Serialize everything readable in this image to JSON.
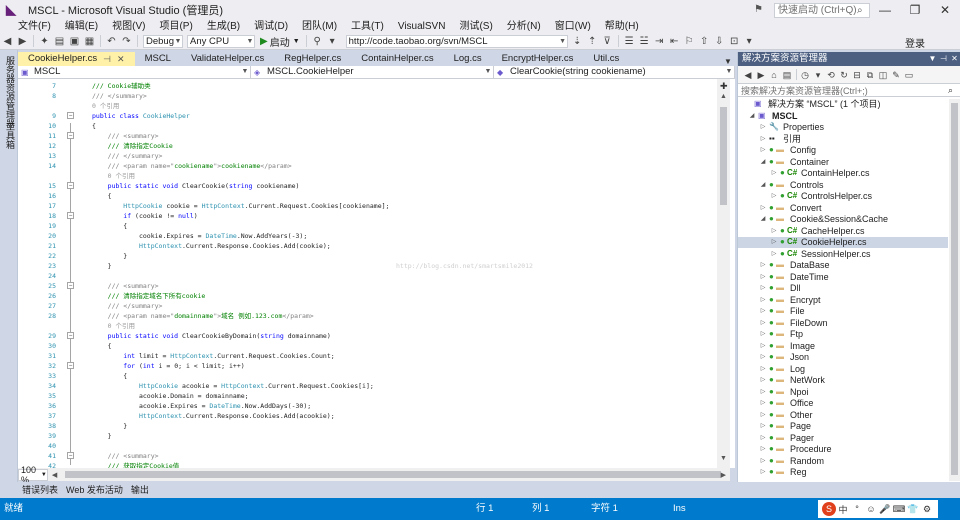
{
  "window": {
    "title": "MSCL - Microsoft Visual Studio (管理员)",
    "quick_launch_placeholder": "快速启动 (Ctrl+Q)",
    "buttons": {
      "minimize": "—",
      "restore": "❐",
      "close": "✕"
    }
  },
  "menu": {
    "items": [
      "文件(F)",
      "编辑(E)",
      "视图(V)",
      "项目(P)",
      "生成(B)",
      "调试(D)",
      "团队(M)",
      "工具(T)",
      "VisualSVN",
      "测试(S)",
      "分析(N)",
      "窗口(W)",
      "帮助(H)"
    ],
    "login": "登录"
  },
  "toolbar": {
    "config": "Debug",
    "platform": "Any CPU",
    "start_label": "启动",
    "url": "http://code.taobao.org/svn/MSCL"
  },
  "left_tabs": [
    "服务器资源管理器",
    "工具箱"
  ],
  "tabs": [
    {
      "label": "CookieHelper.cs",
      "active": true
    },
    {
      "label": "MSCL",
      "active": false
    },
    {
      "label": "ValidateHelper.cs",
      "active": false
    },
    {
      "label": "RegHelper.cs",
      "active": false
    },
    {
      "label": "ContainHelper.cs",
      "active": false
    },
    {
      "label": "Log.cs",
      "active": false
    },
    {
      "label": "EncryptHelper.cs",
      "active": false
    },
    {
      "label": "Util.cs",
      "active": false
    }
  ],
  "navbar": {
    "project": "MSCL",
    "class": "MSCL.CookieHelper",
    "member": "ClearCookie(string cookiename)"
  },
  "editor": {
    "watermark": "http://blog.csdn.net/smartsmile2012",
    "lines": [
      {
        "n": "7",
        "segs": [
          [
            "cm",
            "/// Cookie辅助类"
          ]
        ]
      },
      {
        "n": "8",
        "segs": [
          [
            "gr",
            "/// </summary>"
          ]
        ]
      },
      {
        "n": "",
        "segs": [
          [
            "ref",
            "0 个引用"
          ]
        ]
      },
      {
        "n": "9",
        "segs": [
          [
            "kw",
            "public class "
          ],
          [
            "ty",
            "CookieHelper"
          ]
        ]
      },
      {
        "n": "10",
        "segs": [
          [
            "tx",
            "{"
          ]
        ]
      },
      {
        "n": "11",
        "segs": [
          [
            "gr",
            "    /// <summary>"
          ]
        ]
      },
      {
        "n": "12",
        "segs": [
          [
            "cm",
            "    /// 清除指定Cookie"
          ]
        ]
      },
      {
        "n": "13",
        "segs": [
          [
            "gr",
            "    /// </summary>"
          ]
        ]
      },
      {
        "n": "14",
        "segs": [
          [
            "gr",
            "    /// <param name=\""
          ],
          [
            "cm",
            "cookiename"
          ],
          [
            "gr",
            "\">"
          ],
          [
            "cm",
            "cookiename"
          ],
          [
            "gr",
            "</param>"
          ]
        ]
      },
      {
        "n": "",
        "segs": [
          [
            "ref",
            "    0 个引用"
          ]
        ]
      },
      {
        "n": "15",
        "segs": [
          [
            "kw",
            "    public static void "
          ],
          [
            "tx",
            "ClearCookie("
          ],
          [
            "kw",
            "string "
          ],
          [
            "tx",
            "cookiename)"
          ]
        ]
      },
      {
        "n": "16",
        "segs": [
          [
            "tx",
            "    {"
          ]
        ]
      },
      {
        "n": "17",
        "segs": [
          [
            "ty",
            "        HttpCookie "
          ],
          [
            "tx",
            "cookie = "
          ],
          [
            "ty",
            "HttpContext"
          ],
          [
            "tx",
            ".Current.Request.Cookies[cookiename];"
          ]
        ]
      },
      {
        "n": "18",
        "segs": [
          [
            "kw",
            "        if "
          ],
          [
            "tx",
            "(cookie != "
          ],
          [
            "kw",
            "null"
          ],
          [
            "tx",
            ")"
          ]
        ]
      },
      {
        "n": "19",
        "segs": [
          [
            "tx",
            "        {"
          ]
        ]
      },
      {
        "n": "20",
        "segs": [
          [
            "tx",
            "            cookie.Expires = "
          ],
          [
            "ty",
            "DateTime"
          ],
          [
            "tx",
            ".Now.AddYears(-3);"
          ]
        ]
      },
      {
        "n": "21",
        "segs": [
          [
            "ty",
            "            HttpContext"
          ],
          [
            "tx",
            ".Current.Response.Cookies.Add(cookie);"
          ]
        ]
      },
      {
        "n": "22",
        "segs": [
          [
            "tx",
            "        }"
          ]
        ]
      },
      {
        "n": "23",
        "segs": [
          [
            "tx",
            "    }"
          ]
        ]
      },
      {
        "n": "24",
        "segs": []
      },
      {
        "n": "25",
        "segs": [
          [
            "gr",
            "    /// <summary>"
          ]
        ]
      },
      {
        "n": "26",
        "segs": [
          [
            "cm",
            "    /// 清除指定域名下所有cookie"
          ]
        ]
      },
      {
        "n": "27",
        "segs": [
          [
            "gr",
            "    /// </summary>"
          ]
        ]
      },
      {
        "n": "28",
        "segs": [
          [
            "gr",
            "    /// <param name=\""
          ],
          [
            "cm",
            "domainname"
          ],
          [
            "gr",
            "\">"
          ],
          [
            "cm",
            "域名 例如.123.com"
          ],
          [
            "gr",
            "</param>"
          ]
        ]
      },
      {
        "n": "",
        "segs": [
          [
            "ref",
            "    0 个引用"
          ]
        ]
      },
      {
        "n": "29",
        "segs": [
          [
            "kw",
            "    public static void "
          ],
          [
            "tx",
            "ClearCookieByDomain("
          ],
          [
            "kw",
            "string "
          ],
          [
            "tx",
            "domainname)"
          ]
        ]
      },
      {
        "n": "30",
        "segs": [
          [
            "tx",
            "    {"
          ]
        ]
      },
      {
        "n": "31",
        "segs": [
          [
            "kw",
            "        int "
          ],
          [
            "tx",
            "limit = "
          ],
          [
            "ty",
            "HttpContext"
          ],
          [
            "tx",
            ".Current.Request.Cookies.Count;"
          ]
        ]
      },
      {
        "n": "32",
        "segs": [
          [
            "kw",
            "        for "
          ],
          [
            "tx",
            "("
          ],
          [
            "kw",
            "int "
          ],
          [
            "tx",
            "i = 0; i < limit; i++)"
          ]
        ]
      },
      {
        "n": "33",
        "segs": [
          [
            "tx",
            "        {"
          ]
        ]
      },
      {
        "n": "34",
        "segs": [
          [
            "ty",
            "            HttpCookie "
          ],
          [
            "tx",
            "acookie = "
          ],
          [
            "ty",
            "HttpContext"
          ],
          [
            "tx",
            ".Current.Request.Cookies[i];"
          ]
        ]
      },
      {
        "n": "35",
        "segs": [
          [
            "tx",
            "            acookie.Domain = domainname;"
          ]
        ]
      },
      {
        "n": "36",
        "segs": [
          [
            "tx",
            "            acookie.Expires = "
          ],
          [
            "ty",
            "DateTime"
          ],
          [
            "tx",
            ".Now.AddDays(-30);"
          ]
        ]
      },
      {
        "n": "37",
        "segs": [
          [
            "ty",
            "            HttpContext"
          ],
          [
            "tx",
            ".Current.Response.Cookies.Add(acookie);"
          ]
        ]
      },
      {
        "n": "38",
        "segs": [
          [
            "tx",
            "        }"
          ]
        ]
      },
      {
        "n": "39",
        "segs": [
          [
            "tx",
            "    }"
          ]
        ]
      },
      {
        "n": "40",
        "segs": []
      },
      {
        "n": "41",
        "segs": [
          [
            "gr",
            "    /// <summary>"
          ]
        ]
      },
      {
        "n": "42",
        "segs": [
          [
            "cm",
            "    /// 获取指定Cookie值"
          ]
        ]
      }
    ]
  },
  "zoom": "100 %",
  "solution_explorer": {
    "title": "解决方案资源管理器",
    "search_placeholder": "搜索解决方案资源管理器(Ctrl+;)",
    "nodes": [
      {
        "label": "解决方案 “MSCL” (1 个项目)",
        "depth": 0,
        "kind": "solution",
        "arrow": ""
      },
      {
        "label": "MSCL",
        "depth": 0,
        "kind": "project",
        "arrow": "open"
      },
      {
        "label": "Properties",
        "depth": 1,
        "kind": "props",
        "arrow": "closed"
      },
      {
        "label": "引用",
        "depth": 1,
        "kind": "refs",
        "arrow": "closed"
      },
      {
        "label": "Config",
        "depth": 1,
        "kind": "folder",
        "arrow": "closed"
      },
      {
        "label": "Container",
        "depth": 1,
        "kind": "folder",
        "arrow": "open"
      },
      {
        "label": "ContainHelper.cs",
        "depth": 2,
        "kind": "cs",
        "arrow": "closed"
      },
      {
        "label": "Controls",
        "depth": 1,
        "kind": "folder",
        "arrow": "open"
      },
      {
        "label": "ControlsHelper.cs",
        "depth": 2,
        "kind": "cs",
        "arrow": "closed"
      },
      {
        "label": "Convert",
        "depth": 1,
        "kind": "folder",
        "arrow": "closed"
      },
      {
        "label": "Cookie&Session&Cache",
        "depth": 1,
        "kind": "folder",
        "arrow": "open"
      },
      {
        "label": "CacheHelper.cs",
        "depth": 2,
        "kind": "cs",
        "arrow": "closed"
      },
      {
        "label": "CookieHelper.cs",
        "depth": 2,
        "kind": "cs",
        "arrow": "closed",
        "selected": true
      },
      {
        "label": "SessionHelper.cs",
        "depth": 2,
        "kind": "cs",
        "arrow": "closed"
      },
      {
        "label": "DataBase",
        "depth": 1,
        "kind": "folder",
        "arrow": "closed"
      },
      {
        "label": "DateTime",
        "depth": 1,
        "kind": "folder",
        "arrow": "closed"
      },
      {
        "label": "Dll",
        "depth": 1,
        "kind": "folder",
        "arrow": "closed"
      },
      {
        "label": "Encrypt",
        "depth": 1,
        "kind": "folder",
        "arrow": "closed"
      },
      {
        "label": "File",
        "depth": 1,
        "kind": "folder",
        "arrow": "closed"
      },
      {
        "label": "FileDown",
        "depth": 1,
        "kind": "folder",
        "arrow": "closed"
      },
      {
        "label": "Ftp",
        "depth": 1,
        "kind": "folder",
        "arrow": "closed"
      },
      {
        "label": "Image",
        "depth": 1,
        "kind": "folder",
        "arrow": "closed"
      },
      {
        "label": "Json",
        "depth": 1,
        "kind": "folder",
        "arrow": "closed"
      },
      {
        "label": "Log",
        "depth": 1,
        "kind": "folder",
        "arrow": "closed"
      },
      {
        "label": "NetWork",
        "depth": 1,
        "kind": "folder",
        "arrow": "closed"
      },
      {
        "label": "Npoi",
        "depth": 1,
        "kind": "folder",
        "arrow": "closed"
      },
      {
        "label": "Office",
        "depth": 1,
        "kind": "folder",
        "arrow": "closed"
      },
      {
        "label": "Other",
        "depth": 1,
        "kind": "folder",
        "arrow": "closed"
      },
      {
        "label": "Page",
        "depth": 1,
        "kind": "folder",
        "arrow": "closed"
      },
      {
        "label": "Pager",
        "depth": 1,
        "kind": "folder",
        "arrow": "closed"
      },
      {
        "label": "Procedure",
        "depth": 1,
        "kind": "folder",
        "arrow": "closed"
      },
      {
        "label": "Random",
        "depth": 1,
        "kind": "folder",
        "arrow": "closed"
      },
      {
        "label": "Reg",
        "depth": 1,
        "kind": "folder",
        "arrow": "closed"
      }
    ]
  },
  "bottom_tabs": [
    "错误列表",
    "Web 发布活动",
    "输出"
  ],
  "status": {
    "ready": "就绪",
    "row": "行 1",
    "col": "列 1",
    "char": "字符 1",
    "mode": "Ins",
    "ime": [
      "中",
      "°",
      "☺",
      "🎤",
      "⌨",
      "👕",
      "⚙"
    ]
  },
  "colors": {
    "accent": "#007acc",
    "active_tab": "#fff1a8",
    "panel_header": "#4d6082"
  }
}
